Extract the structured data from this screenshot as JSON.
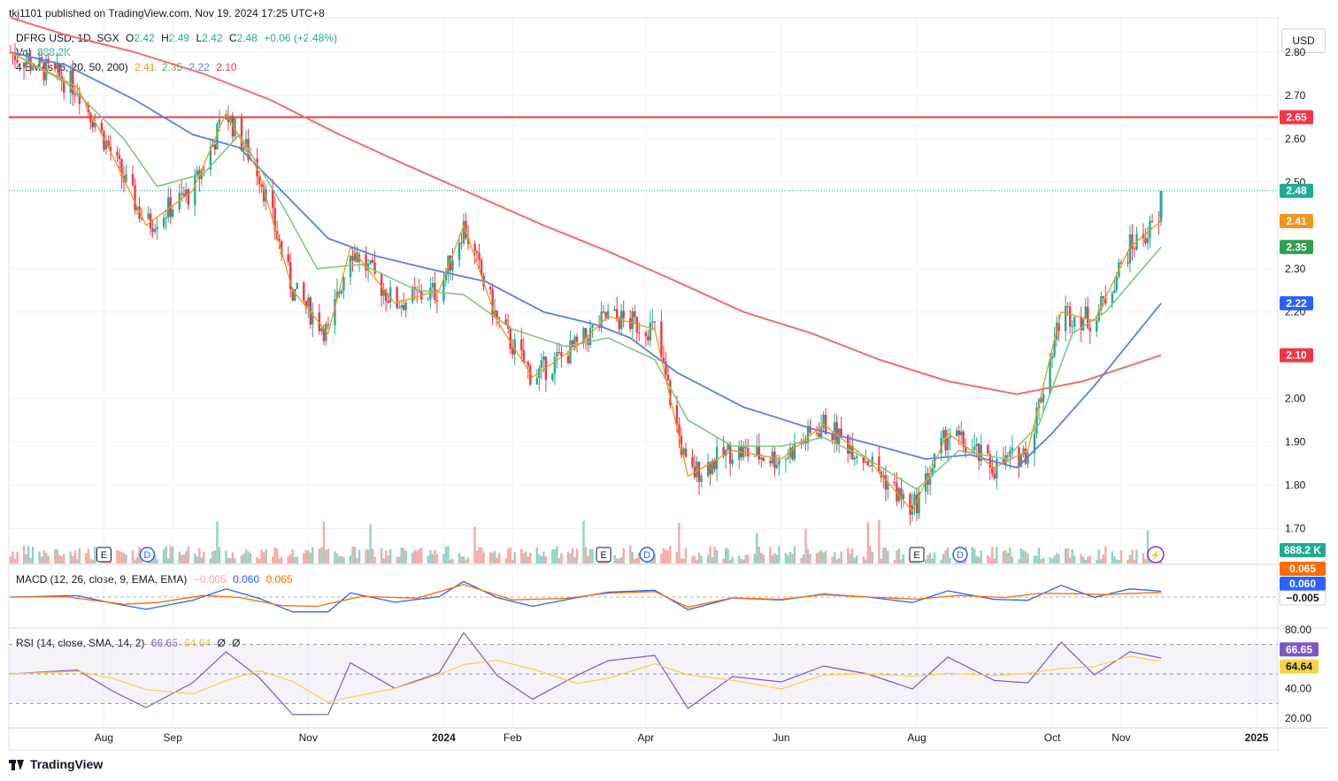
{
  "header": {
    "published": "tkj1101 published on TradingView.com, Nov 19, 2024 17:25 UTC+8"
  },
  "legend": {
    "symbol": "DFRG USD, 1D, SGX",
    "o_label": "O",
    "o": "2.42",
    "h_label": "H",
    "h": "2.49",
    "l_label": "L",
    "l": "2.42",
    "c_label": "C",
    "c": "2.48",
    "change": "+0.06 (+2.48%)",
    "vol_label": "Vol",
    "vol": "888.2K",
    "emas_label": "4 EMAs (5, 20, 50, 200)",
    "ema5": "2.41",
    "ema20": "2.35",
    "ema50": "2.22",
    "ema200": "2.10"
  },
  "currency_button": "USD",
  "macd_legend": {
    "label": "MACD (12, 26, close, 9, EMA, EMA)",
    "hist": "−0.005",
    "macd": "0.060",
    "signal": "0.065"
  },
  "rsi_legend": {
    "label": "RSI (14, close, SMA, 14, 2)",
    "rsi": "66.65",
    "ma": "64.64",
    "a": "Ø",
    "b": "Ø"
  },
  "footer": {
    "brand": "TradingView"
  },
  "colors": {
    "up": "#22ab94",
    "down": "#f23645",
    "ema5": "#f7931a",
    "ema20": "#81c784",
    "ema50": "#5b7fe3",
    "ema200": "#f26d6d",
    "hline": "#f23645",
    "rsi": "#7e57c2",
    "rsi_ma": "#f5d547",
    "macd": "#2962ff",
    "signal": "#ff6d00"
  },
  "chart_data": {
    "type": "candlestick",
    "price_axis": {
      "ticks": [
        "2.80",
        "2.70",
        "2.60",
        "2.50",
        "2.30",
        "2.20",
        "2.00",
        "1.90",
        "1.80",
        "1.70"
      ],
      "range": [
        1.67,
        2.88
      ]
    },
    "time_axis": {
      "labels": [
        "Aug",
        "Sep",
        "Nov",
        "2024",
        "Feb",
        "Apr",
        "Jun",
        "Aug",
        "Oct",
        "Nov",
        "2025"
      ]
    },
    "price_labels": [
      {
        "value": "2.65",
        "kind": "hline"
      },
      {
        "value": "2.48",
        "kind": "last"
      },
      {
        "value": "2.41",
        "kind": "ema5"
      },
      {
        "value": "2.35",
        "kind": "ema20"
      },
      {
        "value": "2.22",
        "kind": "ema50"
      },
      {
        "value": "2.10",
        "kind": "ema200"
      }
    ],
    "horizontal_line": 2.65,
    "volume_label": "888.2 K",
    "events": [
      {
        "date": "2023-08",
        "labels": [
          "E",
          "D"
        ]
      },
      {
        "date": "2024-03",
        "labels": [
          "E",
          "D"
        ]
      },
      {
        "date": "2024-08",
        "labels": [
          "E",
          "D"
        ]
      }
    ],
    "ema200_path": [
      [
        "2023-06-20",
        2.88
      ],
      [
        "2023-07-15",
        2.84
      ],
      [
        "2023-08-15",
        2.8
      ],
      [
        "2023-09-15",
        2.75
      ],
      [
        "2023-10-15",
        2.69
      ],
      [
        "2023-11-15",
        2.61
      ],
      [
        "2023-12-15",
        2.54
      ],
      [
        "2024-01-15",
        2.47
      ],
      [
        "2024-02-15",
        2.4
      ],
      [
        "2024-03-15",
        2.34
      ],
      [
        "2024-04-15",
        2.27
      ],
      [
        "2024-05-15",
        2.2
      ],
      [
        "2024-06-15",
        2.15
      ],
      [
        "2024-07-15",
        2.09
      ],
      [
        "2024-08-15",
        2.04
      ],
      [
        "2024-09-15",
        2.01
      ],
      [
        "2024-10-15",
        2.04
      ],
      [
        "2024-11-19",
        2.1
      ]
    ],
    "ema50_path": [
      [
        "2023-06-20",
        2.8
      ],
      [
        "2023-07-15",
        2.77
      ],
      [
        "2023-08-15",
        2.69
      ],
      [
        "2023-09-10",
        2.61
      ],
      [
        "2023-10-01",
        2.58
      ],
      [
        "2023-10-20",
        2.48
      ],
      [
        "2023-11-10",
        2.37
      ],
      [
        "2023-12-01",
        2.33
      ],
      [
        "2023-12-25",
        2.3
      ],
      [
        "2024-01-20",
        2.27
      ],
      [
        "2024-02-15",
        2.2
      ],
      [
        "2024-03-10",
        2.17
      ],
      [
        "2024-03-25",
        2.14
      ],
      [
        "2024-04-15",
        2.06
      ],
      [
        "2024-05-15",
        1.98
      ],
      [
        "2024-06-15",
        1.93
      ],
      [
        "2024-07-15",
        1.89
      ],
      [
        "2024-08-05",
        1.86
      ],
      [
        "2024-08-25",
        1.87
      ],
      [
        "2024-09-15",
        1.84
      ],
      [
        "2024-10-01",
        1.92
      ],
      [
        "2024-10-20",
        2.03
      ],
      [
        "2024-11-19",
        2.22
      ]
    ],
    "ema20_path": [
      [
        "2023-06-20",
        2.8
      ],
      [
        "2023-07-15",
        2.73
      ],
      [
        "2023-08-10",
        2.6
      ],
      [
        "2023-08-25",
        2.49
      ],
      [
        "2023-09-15",
        2.52
      ],
      [
        "2023-10-01",
        2.61
      ],
      [
        "2023-10-20",
        2.45
      ],
      [
        "2023-11-05",
        2.3
      ],
      [
        "2023-11-25",
        2.31
      ],
      [
        "2023-12-20",
        2.25
      ],
      [
        "2024-01-10",
        2.24
      ],
      [
        "2024-02-01",
        2.16
      ],
      [
        "2024-02-25",
        2.12
      ],
      [
        "2024-03-15",
        2.14
      ],
      [
        "2024-04-05",
        2.09
      ],
      [
        "2024-04-20",
        1.95
      ],
      [
        "2024-05-10",
        1.89
      ],
      [
        "2024-06-01",
        1.89
      ],
      [
        "2024-06-20",
        1.91
      ],
      [
        "2024-07-10",
        1.86
      ],
      [
        "2024-08-01",
        1.79
      ],
      [
        "2024-08-20",
        1.88
      ],
      [
        "2024-09-10",
        1.86
      ],
      [
        "2024-09-25",
        1.94
      ],
      [
        "2024-10-10",
        2.15
      ],
      [
        "2024-10-25",
        2.2
      ],
      [
        "2024-11-19",
        2.35
      ]
    ],
    "ema5_path": [
      [
        "2023-06-20",
        2.8
      ],
      [
        "2023-07-20",
        2.72
      ],
      [
        "2023-08-05",
        2.56
      ],
      [
        "2023-08-20",
        2.4
      ],
      [
        "2023-09-10",
        2.48
      ],
      [
        "2023-09-25",
        2.66
      ],
      [
        "2023-10-10",
        2.52
      ],
      [
        "2023-10-25",
        2.25
      ],
      [
        "2023-11-10",
        2.15
      ],
      [
        "2023-11-20",
        2.35
      ],
      [
        "2023-12-10",
        2.22
      ],
      [
        "2023-12-30",
        2.25
      ],
      [
        "2024-01-10",
        2.4
      ],
      [
        "2024-01-25",
        2.18
      ],
      [
        "2024-02-10",
        2.05
      ],
      [
        "2024-03-01",
        2.12
      ],
      [
        "2024-03-15",
        2.19
      ],
      [
        "2024-04-05",
        2.16
      ],
      [
        "2024-04-20",
        1.82
      ],
      [
        "2024-05-10",
        1.88
      ],
      [
        "2024-06-01",
        1.86
      ],
      [
        "2024-06-20",
        1.94
      ],
      [
        "2024-07-10",
        1.86
      ],
      [
        "2024-07-30",
        1.74
      ],
      [
        "2024-08-15",
        1.92
      ],
      [
        "2024-09-05",
        1.84
      ],
      [
        "2024-09-20",
        1.88
      ],
      [
        "2024-10-05",
        2.2
      ],
      [
        "2024-10-20",
        2.18
      ],
      [
        "2024-11-05",
        2.35
      ],
      [
        "2024-11-19",
        2.41
      ]
    ]
  }
}
